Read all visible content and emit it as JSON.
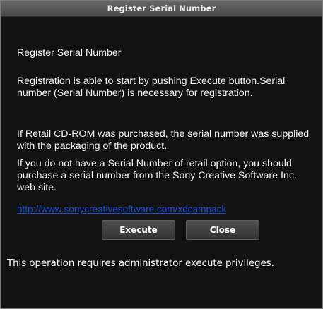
{
  "window": {
    "title": "Register Serial Number"
  },
  "dialog": {
    "heading": "Register Serial Number",
    "paragraph1": "Registration is able to start by pushing Execute button.Serial number (Serial Number) is necessary for registration.",
    "paragraph2": "If Retail CD-ROM was purchased, the serial number was supplied with the packaging of the product.",
    "paragraph3": "If you do not have a Serial Number of retail option, you should purchase a serial number from the Sony Creative Software Inc. web site.",
    "link_text": "http://www.sonycreativesoftware.com/xdcampack",
    "footer_note": "This operation requires administrator execute privileges."
  },
  "buttons": {
    "execute_label": "Execute",
    "close_label": "Close"
  },
  "colors": {
    "background": "#121212",
    "titlebar": "#5a5a5a",
    "link": "#1a4fd6",
    "text": "#f4f4f4"
  }
}
